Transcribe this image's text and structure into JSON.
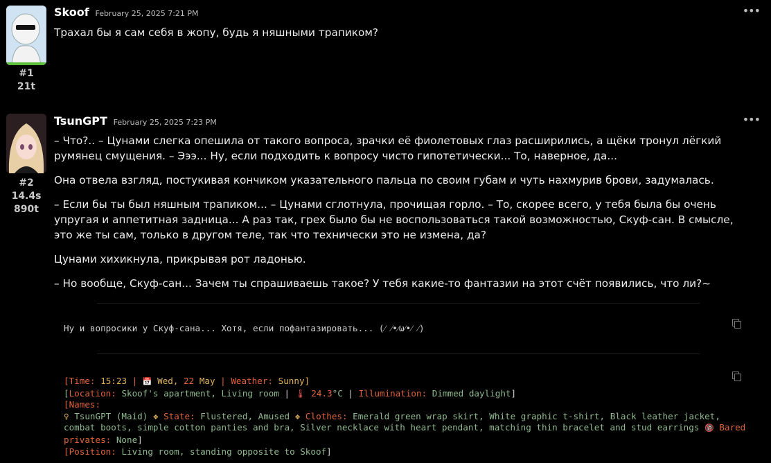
{
  "messages": [
    {
      "author": "Skoof",
      "date": "February 25, 2025 7:21 PM",
      "index": "#1",
      "tokens": "21t",
      "text": "Трахал бы я сам себя в жопу, будь я няшными трапиком?"
    },
    {
      "author": "TsunGPT",
      "date": "February 25, 2025 7:23 PM",
      "index": "#2",
      "time": "14.4s",
      "tokens": "890t",
      "paragraphs": [
        "– Что?.. – Цунами слегка опешила от такого вопроса, зрачки её фиолетовых глаз расширились, а щёки тронул лёгкий румянец смущения. – Эээ... Ну, если подходить к вопросу чисто гипотетически... То, наверное, да...",
        "Она отвела взгляд, постукивая кончиком указательного пальца по своим губам и чуть нахмурив брови, задумалась.",
        "– Если бы ты был няшным трапиком... – Цунами сглотнула, прочищая горло. – То, скорее всего, у тебя была бы очень упругая и аппетитная задница... А раз так, грех было бы не воспользоваться такой возможностью, Скуф-сан. В смысле, это же ты сам, только в другом теле, так что технически это не измена, да?",
        "Цунами хихикнула, прикрывая рот ладонью.",
        "– Но вообще, Скуф-сан... Зачем ты спрашиваешь такое? У тебя какие-то фантазии на этот счёт появились, что ли?~"
      ],
      "code1": "Ну и вопросики у Скуф-сана... Хотя, если пофантазировать... (⁄ ⁄•⁄ω⁄•⁄ ⁄)",
      "status": {
        "time_label": "Time:",
        "time": "15:23",
        "calendar_icon": "📅",
        "day": "Wed,",
        "date_num": "22",
        "month": "May",
        "weather_label": "Weather:",
        "weather": "Sunny",
        "location_label": "Location:",
        "location": "Skoof's apartment, Living room",
        "thermo_icon": "🌡",
        "temp_num": "24.3",
        "temp_unit": "°C",
        "illum_label": "Illumination:",
        "illum": "Dimmed daylight",
        "names_label": "Names:",
        "female_icon": "♀",
        "char": "TsunGPT (Maid)",
        "sep": "❖",
        "state_label": "State:",
        "state": "Flustered, Amused",
        "clothes_label": "Clothes:",
        "clothes": "Emerald green wrap skirt, White graphic t-shirt, Black leather jacket, combat boots, simple cotton panties and bra, Silver necklace with heart pendant, matching thin bracelet and stud earrings",
        "nsfw_icon": "🔞",
        "bared_label": "Bared privates:",
        "bared": "None",
        "position_label": "Position:",
        "position": "Living room, standing opposite to Skoof"
      }
    }
  ]
}
